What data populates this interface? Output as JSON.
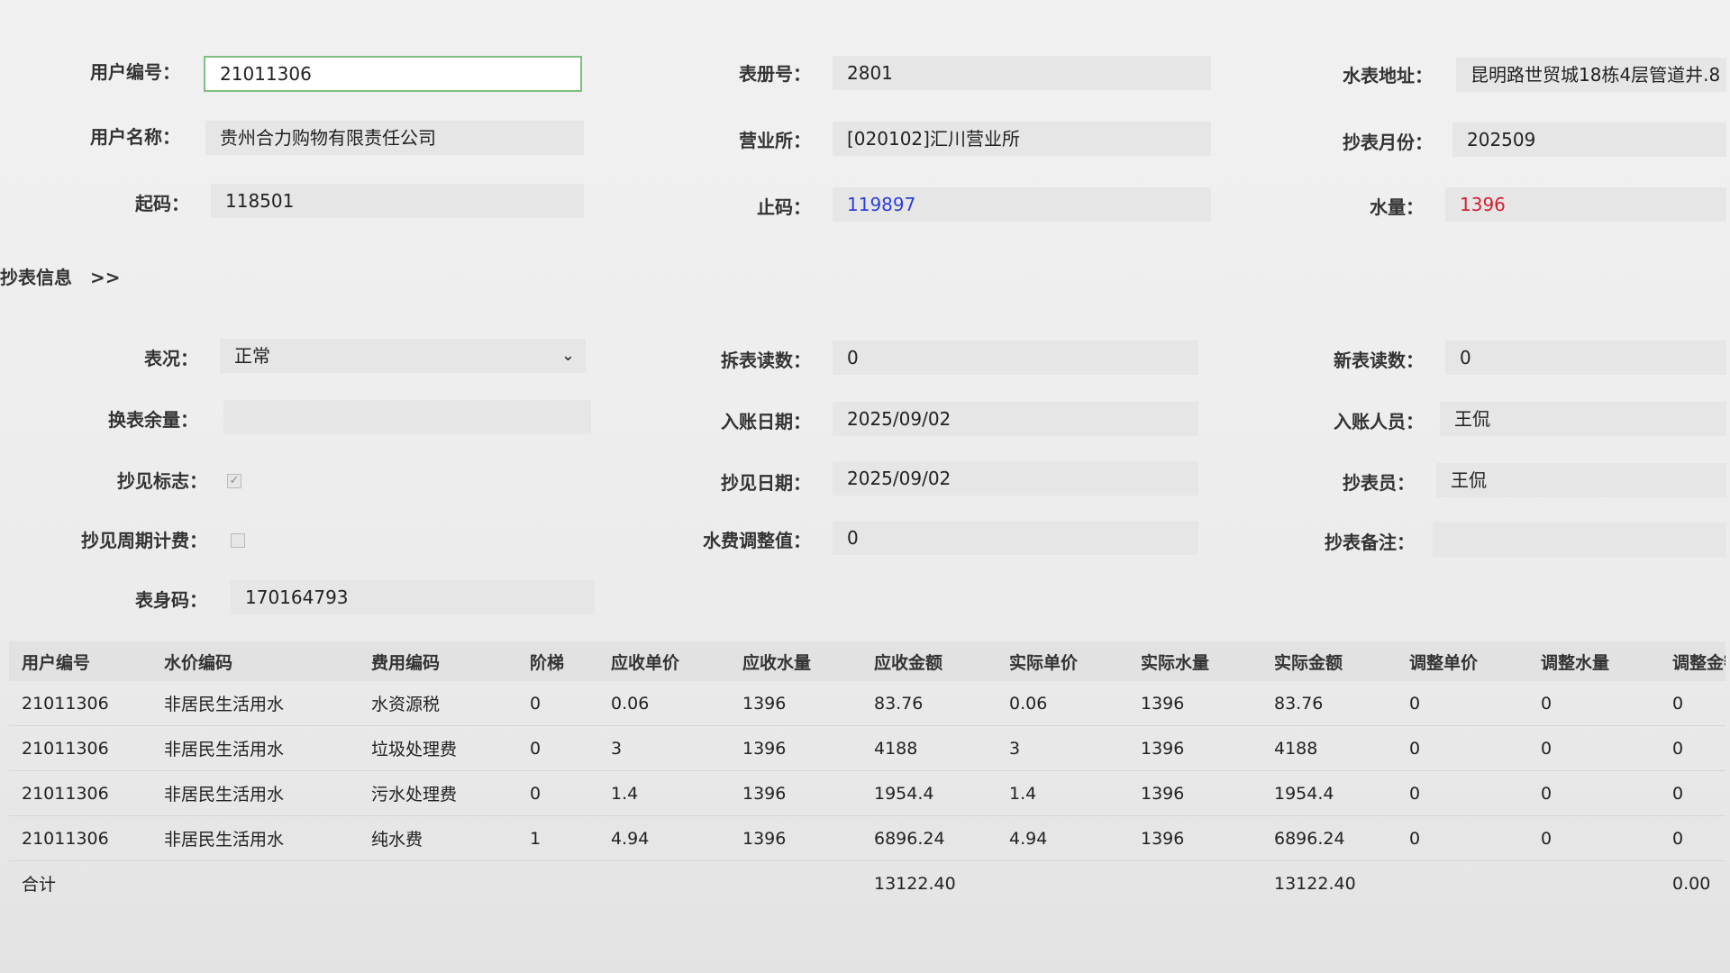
{
  "top": {
    "user_no_label": "用户编号：",
    "user_no_value": "21011306",
    "book_no_label": "表册号：",
    "book_no_value": "2801",
    "meter_addr_label": "水表地址：",
    "meter_addr_value": "昆明路世贸城18栋4层管道井.8",
    "user_name_label": "用户名称：",
    "user_name_value": "贵州合力购物有限责任公司",
    "office_label": "营业所：",
    "office_value": "[020102]汇川营业所",
    "read_month_label": "抄表月份：",
    "read_month_value": "202509",
    "start_code_label": "起码：",
    "start_code_value": "118501",
    "end_code_label": "止码：",
    "end_code_value": "119897",
    "water_qty_label": "水量：",
    "water_qty_value": "1396"
  },
  "section_title": "抄表信息　>>",
  "reading": {
    "status_label": "表况：",
    "status_value": "正常",
    "dismantle_label": "拆表读数：",
    "dismantle_value": "0",
    "new_meter_label": "新表读数：",
    "new_meter_value": "0",
    "replace_balance_label": "换表余量：",
    "replace_balance_value": "",
    "post_date_label": "入账日期：",
    "post_date_value": "2025/09/02",
    "post_person_label": "入账人员：",
    "post_person_value": "王侃",
    "seen_flag_label": "抄见标志：",
    "seen_flag_checked": true,
    "seen_date_label": "抄见日期：",
    "seen_date_value": "2025/09/02",
    "reader_label": "抄表员：",
    "reader_value": "王侃",
    "cycle_fee_label": "抄见周期计费：",
    "cycle_fee_checked": false,
    "fee_adjust_label": "水费调整值：",
    "fee_adjust_value": "0",
    "remark_label": "抄表备注：",
    "remark_value": "",
    "body_code_label": "表身码：",
    "body_code_value": "170164793"
  },
  "table": {
    "headers": [
      "用户编号",
      "水价编码",
      "费用编码",
      "阶梯",
      "应收单价",
      "应收水量",
      "应收金额",
      "实际单价",
      "实际水量",
      "实际金额",
      "调整单价",
      "调整水量",
      "调整金额"
    ],
    "rows": [
      [
        "21011306",
        "非居民生活用水",
        "水资源税",
        "0",
        "0.06",
        "1396",
        "83.76",
        "0.06",
        "1396",
        "83.76",
        "0",
        "0",
        "0"
      ],
      [
        "21011306",
        "非居民生活用水",
        "垃圾处理费",
        "0",
        "3",
        "1396",
        "4188",
        "3",
        "1396",
        "4188",
        "0",
        "0",
        "0"
      ],
      [
        "21011306",
        "非居民生活用水",
        "污水处理费",
        "0",
        "1.4",
        "1396",
        "1954.4",
        "1.4",
        "1396",
        "1954.4",
        "0",
        "0",
        "0"
      ],
      [
        "21011306",
        "非居民生活用水",
        "纯水费",
        "1",
        "4.94",
        "1396",
        "6896.24",
        "4.94",
        "1396",
        "6896.24",
        "0",
        "0",
        "0"
      ]
    ],
    "total_label": "合计",
    "total_receivable": "13122.40",
    "total_actual": "13122.40",
    "total_adjust": "0.00"
  }
}
